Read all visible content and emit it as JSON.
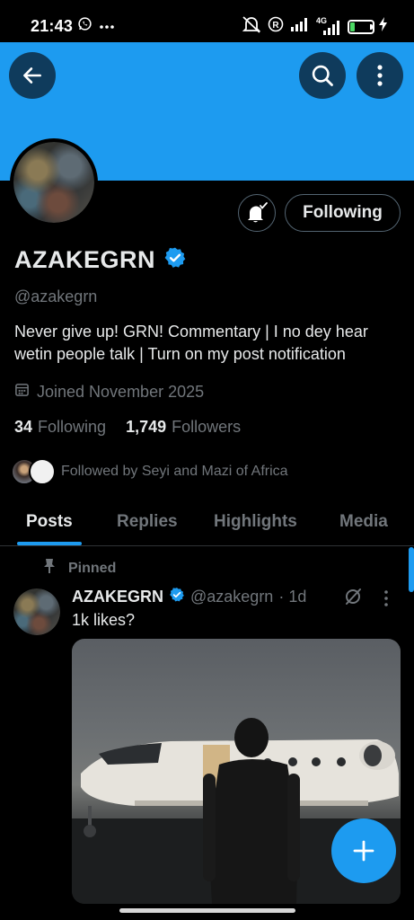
{
  "status_bar": {
    "time": "21:43",
    "network": "4G",
    "battery_level": "21",
    "battery_fraction": 0.21,
    "icons": [
      "whatsapp-icon",
      "more-dots-icon",
      "mute-icon",
      "registered-icon",
      "signal-icon",
      "signal-4g-icon",
      "battery-icon",
      "charging-icon"
    ]
  },
  "colors": {
    "accent": "#1d9bf0",
    "background": "#000000",
    "primary_text": "#e7e9ea",
    "secondary_text": "#71767b",
    "border": "#536471"
  },
  "profile": {
    "display_name": "AZAKEGRN",
    "verified": true,
    "handle": "@azakegrn",
    "bio": "Never give up! GRN! Commentary | I no dey hear wetin people talk | Turn on my post notification",
    "joined": "Joined November 2025",
    "following_count": "34",
    "following_label": "Following",
    "followers_count": "1,749",
    "followers_label": "Followers",
    "followed_by": "Followed by Seyi and Mazi of Africa",
    "follow_button": "Following"
  },
  "tabs": [
    {
      "label": "Posts",
      "active": true
    },
    {
      "label": "Replies",
      "active": false
    },
    {
      "label": "Highlights",
      "active": false
    },
    {
      "label": "Media",
      "active": false
    }
  ],
  "pinned_post": {
    "pinned_label": "Pinned",
    "author_name": "AZAKEGRN",
    "author_handle": "@azakegrn",
    "time": "· 1d",
    "text": "1k likes?"
  }
}
